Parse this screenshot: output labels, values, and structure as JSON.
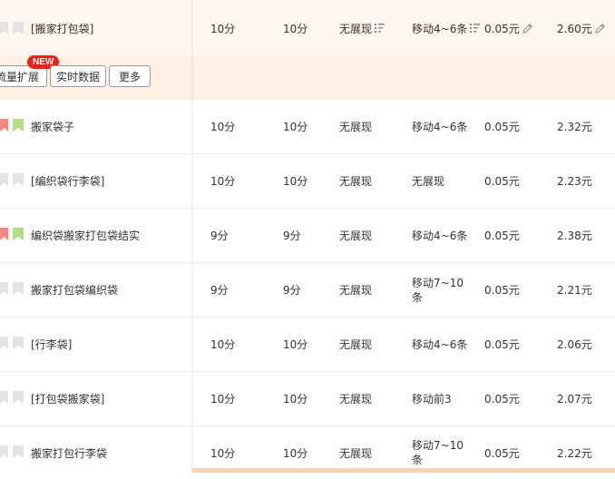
{
  "top_row": {
    "keyword": "[搬家打包袋]",
    "c1": "10分",
    "c2": "10分",
    "c3": "无展现",
    "c4": "移动4~6条",
    "c5": "0.05元",
    "c6": "2.60元"
  },
  "toolbar": {
    "btn1": "流量扩展",
    "btn1_badge": "NEW",
    "btn2": "实时数据",
    "btn3": "更多"
  },
  "rows": [
    {
      "keyword": "搬家袋子",
      "c1": "10分",
      "c2": "10分",
      "c3": "无展现",
      "c4": "移动4~6条",
      "c5": "0.05元",
      "c6": "2.32元"
    },
    {
      "keyword": "[编织袋行李袋]",
      "c1": "10分",
      "c2": "10分",
      "c3": "无展现",
      "c4": "无展现",
      "c5": "0.05元",
      "c6": "2.23元"
    },
    {
      "keyword": "编织袋搬家打包袋结实",
      "c1": "9分",
      "c2": "9分",
      "c3": "无展现",
      "c4": "移动4~6条",
      "c5": "0.05元",
      "c6": "2.38元"
    },
    {
      "keyword": "搬家打包袋编织袋",
      "c1": "9分",
      "c2": "9分",
      "c3": "无展现",
      "c4": "移动7~10条",
      "c5": "0.05元",
      "c6": "2.21元"
    },
    {
      "keyword": "[行李袋]",
      "c1": "10分",
      "c2": "10分",
      "c3": "无展现",
      "c4": "移动4~6条",
      "c5": "0.05元",
      "c6": "2.06元"
    },
    {
      "keyword": "[打包袋搬家袋]",
      "c1": "10分",
      "c2": "10分",
      "c3": "无展现",
      "c4": "移动前3",
      "c5": "0.05元",
      "c6": "2.07元"
    },
    {
      "keyword": "搬家打包行李袋",
      "c1": "10分",
      "c2": "10分",
      "c3": "无展现",
      "c4": "移动7~10条",
      "c5": "0.05元",
      "c6": "2.22元"
    }
  ],
  "colors": {
    "flag_red": "#f7877d",
    "flag_green": "#b7dc8a",
    "flag_gray": "#e3e3e3",
    "badge": "#e8231a"
  }
}
